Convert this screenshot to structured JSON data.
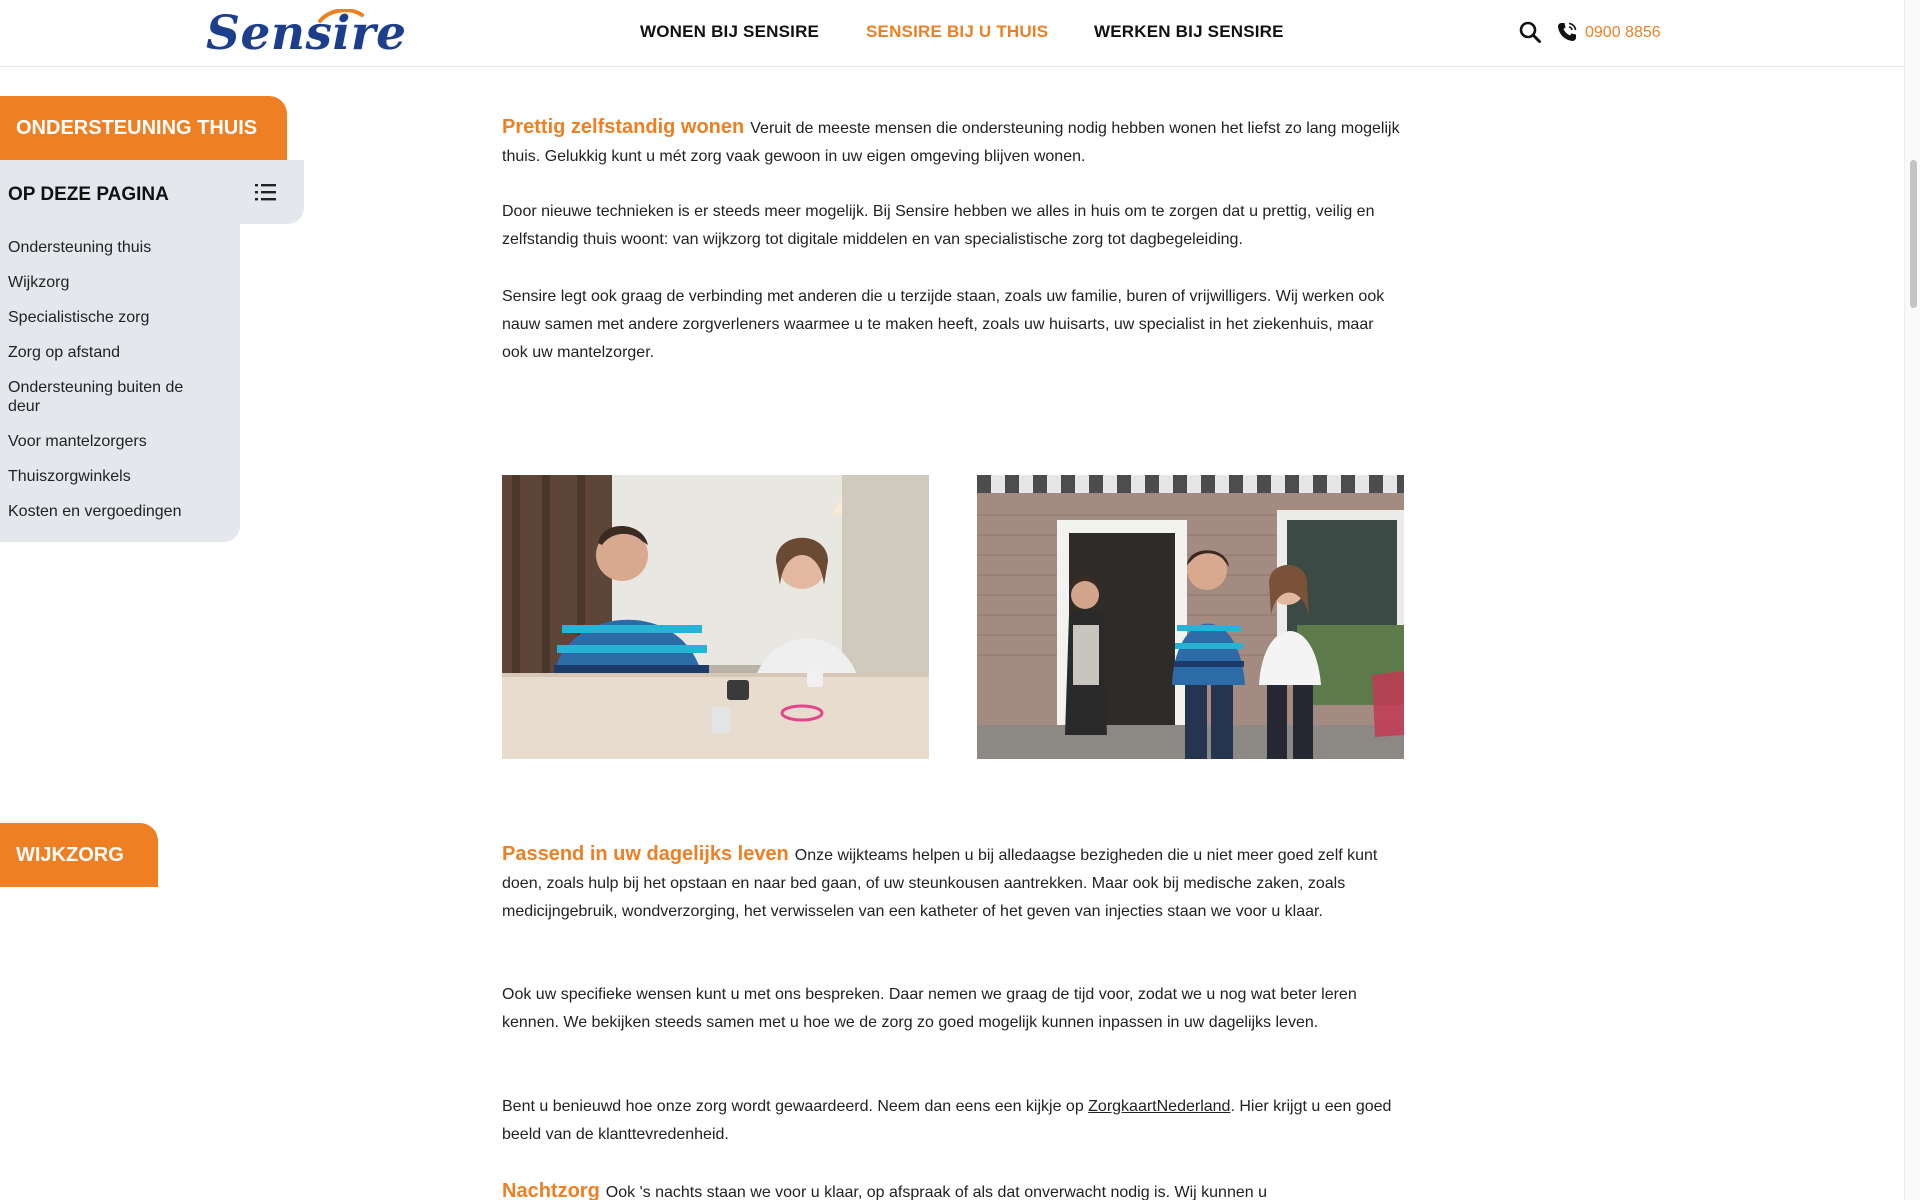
{
  "header": {
    "logo": "Sensire",
    "nav": [
      {
        "label": "WONEN BIJ SENSIRE",
        "active": false
      },
      {
        "label": "SENSIRE BIJ U THUIS",
        "active": true
      },
      {
        "label": "WERKEN BIJ SENSIRE",
        "active": false
      }
    ],
    "search_icon": "search-icon",
    "phone_icon": "phone-icon",
    "phone_number": "0900 8856"
  },
  "sidebar": {
    "section_tab": "ONDERSTEUNING THUIS",
    "toc_title": "OP DEZE PAGINA",
    "toc_icon": "list-icon",
    "toc_items": [
      "Ondersteuning thuis",
      "Wijkzorg",
      "Specialistische zorg",
      "Zorg op afstand",
      "Ondersteuning buiten de deur",
      "Voor mantelzorgers",
      "Thuiszorgwinkels",
      "Kosten en vergoedingen"
    ],
    "second_tab": "WIJKZORG"
  },
  "content": {
    "section1": {
      "lead": "Prettig zelfstandig wonen",
      "p1": "Veruit de meeste mensen die ondersteuning nodig hebben wonen het liefst zo lang mogelijk thuis. Gelukkig kunt u mét zorg vaak gewoon in uw eigen omgeving blijven wonen.",
      "p2": "Door nieuwe technieken is er steeds meer mogelijk. Bij Sensire hebben we alles in huis om te zorgen dat u prettig, veilig en zelfstandig thuis woont: van wijkzorg tot digitale middelen en van specialistische zorg tot dagbegeleiding.",
      "p3": "Sensire legt ook graag de verbinding met anderen die u terzijde staan, zoals uw familie, buren of vrijwilligers. Wij werken ook nauw samen met andere zorgverleners waarmee u te maken heeft, zoals uw huisarts, uw specialist in het ziekenhuis, maar ook uw mantelzorger."
    },
    "section2": {
      "lead": "Passend in uw dagelijks leven",
      "p1": "Onze wijkteams helpen u bij alledaagse bezigheden die u niet meer goed zelf kunt doen, zoals hulp bij het opstaan en naar bed gaan, of uw steunkousen aantrekken. Maar ook bij medische zaken, zoals medicijngebruik, wondverzorging, het verwisselen van een katheter of het geven van injecties staan we voor u klaar.",
      "p2": "Ook uw specifieke wensen kunt u met ons bespreken. Daar nemen we graag de tijd voor, zodat we u nog wat beter leren kennen. We bekijken steeds samen met u hoe we de zorg zo goed mogelijk kunnen inpassen in uw dagelijks leven.",
      "p3_before": "Bent u benieuwd hoe onze zorg wordt gewaardeerd. Neem dan eens een kijkje op ",
      "p3_link": "ZorgkaartNederland",
      "p3_after": ". Hier krijgt u een goed beeld van de klanttevredenheid."
    },
    "section3": {
      "lead": "Nachtzorg",
      "p1": "Ook 's nachts staan we voor u klaar, op afspraak of als dat onverwacht nodig is. Wij kunnen u"
    }
  },
  "colors": {
    "accent": "#ee7f22",
    "logo_blue": "#1c3e8c",
    "toc_bg": "#e4e8ec"
  }
}
